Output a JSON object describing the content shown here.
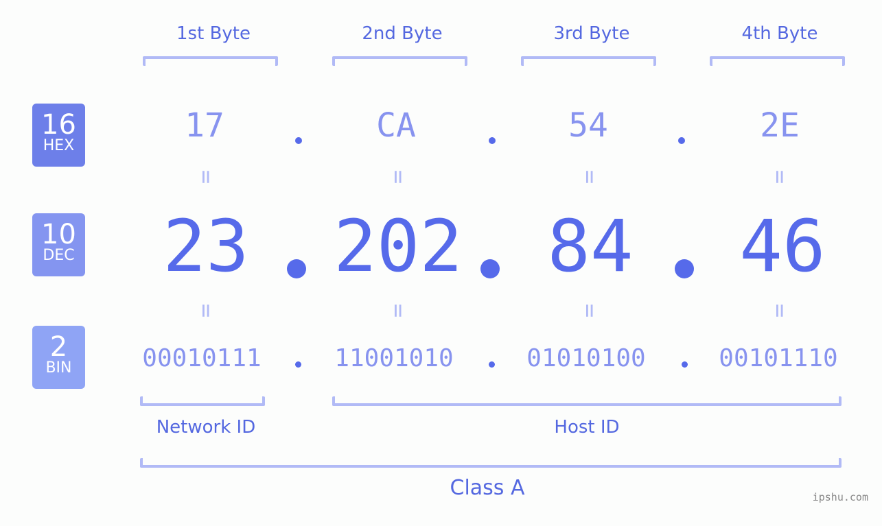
{
  "byte_headers": [
    "1st Byte",
    "2nd Byte",
    "3rd Byte",
    "4th Byte"
  ],
  "badges": {
    "hex": {
      "base": "16",
      "label": "HEX",
      "color": "#6d7fe9"
    },
    "dec": {
      "base": "10",
      "label": "DEC",
      "color": "#8495f0"
    },
    "bin": {
      "base": "2",
      "label": "BIN",
      "color": "#8fa4f5"
    }
  },
  "hex": [
    "17",
    "CA",
    "54",
    "2E"
  ],
  "dec": [
    "23",
    "202",
    "84",
    "46"
  ],
  "bin": [
    "00010111",
    "11001010",
    "01010100",
    "00101110"
  ],
  "equals_sign": "=",
  "network_id_label": "Network ID",
  "host_id_label": "Host ID",
  "class_label": "Class A",
  "watermark": "ipshu.com"
}
